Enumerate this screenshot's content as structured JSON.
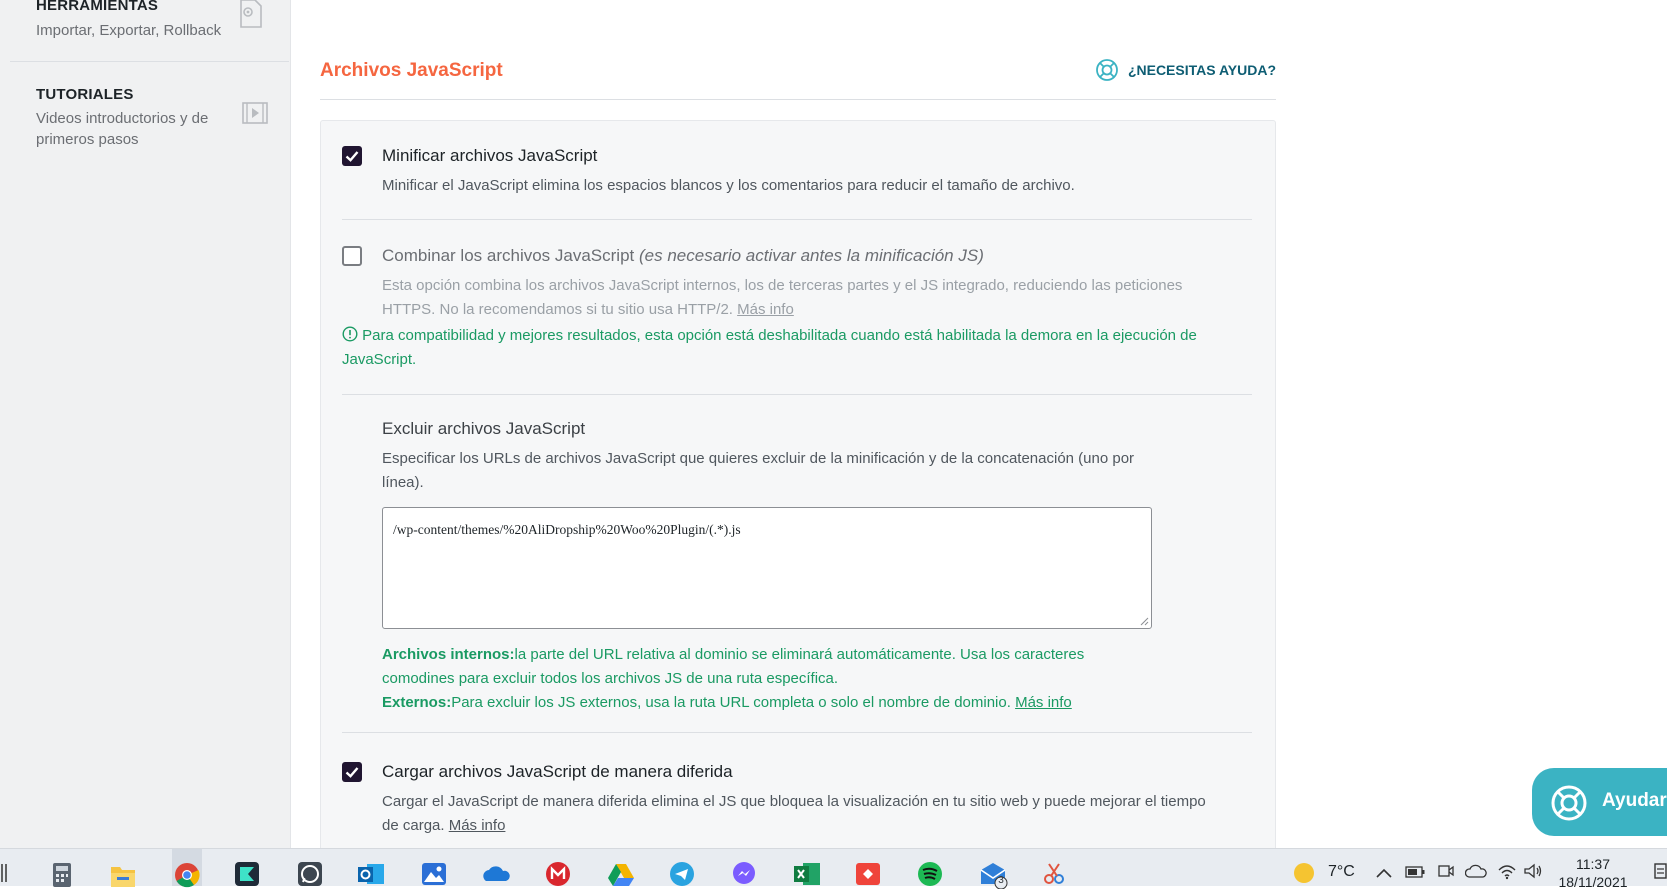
{
  "sidebar": {
    "items": [
      {
        "title": "HERRAMIENTAS",
        "desc": "Importar, Exportar, Rollback",
        "icon": "gear-file-icon"
      },
      {
        "title": "TUTORIALES",
        "desc": "Videos introductorios y de primeros pasos",
        "icon": "video-play-icon"
      }
    ]
  },
  "section": {
    "title": "Archivos JavaScript",
    "help_label": "¿NECESITAS AYUDA?"
  },
  "options": {
    "minify": {
      "label": "Minificar archivos JavaScript",
      "checked": true,
      "desc": "Minificar el JavaScript elimina los espacios blancos y los comentarios para reducir el tamaño de archivo."
    },
    "combine": {
      "label": "Combinar los archivos JavaScript",
      "label_note": "(es necesario activar antes la minificación JS)",
      "checked": false,
      "desc": "Esta opción combina los archivos JavaScript internos, los de terceras partes y el JS integrado, reduciendo las peticiones HTTPS. No la recomendamos si tu sitio usa HTTP/2.",
      "more": "Más info",
      "warning": "Para compatibilidad y mejores resultados, esta opción está deshabilitada cuando está habilitada la demora en la ejecución de JavaScript."
    },
    "exclude": {
      "title": "Excluir archivos JavaScript",
      "desc": "Especificar los URLs de archivos JavaScript que quieres excluir de la minificación y de la concatenación (uno por línea).",
      "value": "/wp-content/themes/%20AliDropship%20Woo%20Plugin/(.*).js",
      "internal_label": "Archivos internos:",
      "internal_text": "la parte del URL relativa al dominio se eliminará automáticamente. Usa los caracteres comodines para excluir todos los archivos JS de una ruta específica.",
      "external_label": "Externos:",
      "external_text": "Para excluir los JS externos, usa la ruta URL completa o solo el nombre de dominio.",
      "more": "Más info"
    },
    "defer": {
      "label": "Cargar archivos JavaScript de manera diferida",
      "checked": true,
      "desc": "Cargar el JavaScript de manera diferida elimina el JS que bloquea la visualización en tu sitio web y puede mejorar el tiempo de carga.",
      "more": "Más info"
    }
  },
  "help_bubble": {
    "label": "Ayudar"
  },
  "taskbar": {
    "apps": [
      "calculator-icon",
      "file-explorer-icon",
      "chrome-icon",
      "filmora-icon",
      "whatsapp-icon",
      "outlook-icon",
      "photos-icon",
      "onedrive-icon",
      "mega-icon",
      "google-drive-icon",
      "telegram-icon",
      "messenger-icon",
      "excel-icon",
      "anydesk-icon",
      "spotify-icon",
      "mail-icon",
      "snip-icon"
    ],
    "mail_badge": "3",
    "weather": "7°C",
    "time": "11:37",
    "date": "18/11/2021"
  },
  "colors": {
    "accent": "#f56640",
    "help_link": "#0e5d73",
    "success": "#1a9a63",
    "checkbox": "#201531",
    "bubble": "#3bb3c3"
  }
}
